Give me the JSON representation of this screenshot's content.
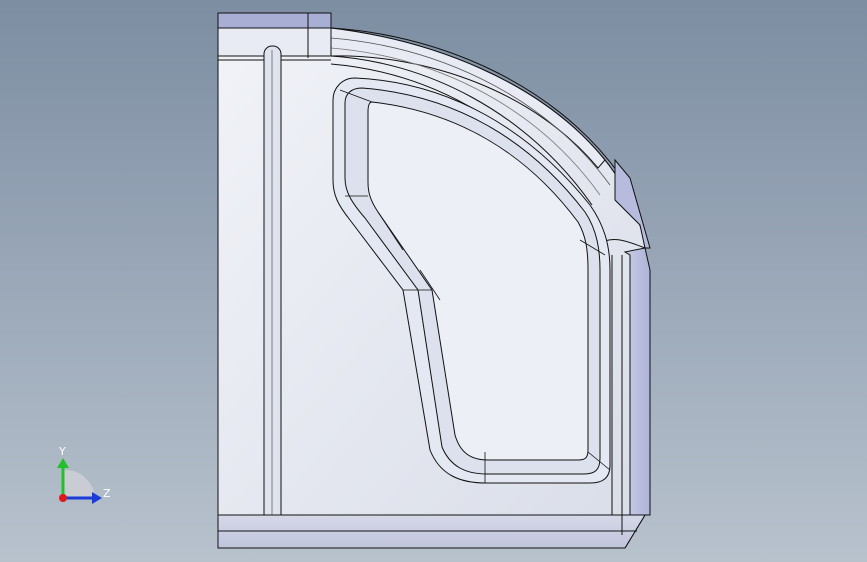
{
  "triad": {
    "y_label": "Y",
    "z_label": "Z",
    "y_color": "#22c02a",
    "z_color": "#1a3cd8",
    "x_color": "#e01818"
  },
  "colors": {
    "part_face": "#e2e6f0",
    "part_edge": "#111111",
    "shadow_face": "#aab0d6"
  }
}
